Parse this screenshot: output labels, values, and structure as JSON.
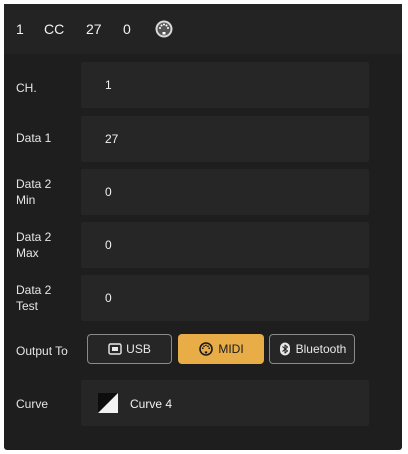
{
  "header": {
    "channel": "1",
    "type": "CC",
    "data1": "27",
    "value": "0",
    "icon": "midi-din-icon"
  },
  "rows": {
    "channel": {
      "label": "CH.",
      "value": "1"
    },
    "data1": {
      "label": "Data 1",
      "value": "27"
    },
    "data2_min": {
      "label_line1": "Data 2",
      "label_line2": "Min",
      "value": "0"
    },
    "data2_max": {
      "label_line1": "Data 2",
      "label_line2": "Max",
      "value": "0"
    },
    "data2_test": {
      "label_line1": "Data 2",
      "label_line2": "Test",
      "value": "0"
    }
  },
  "output_to": {
    "label": "Output To",
    "options": [
      {
        "label": "USB",
        "icon": "usb-icon",
        "selected": false
      },
      {
        "label": "MIDI",
        "icon": "midi-din-icon",
        "selected": true
      },
      {
        "label": "Bluetooth",
        "icon": "bluetooth-icon",
        "selected": false
      }
    ]
  },
  "curve": {
    "label": "Curve",
    "value": "Curve 4",
    "icon": "curve-icon"
  },
  "colors": {
    "background": "#1e1e1e",
    "field": "#262626",
    "accent": "#e9ad48",
    "text": "#f2f2f2"
  }
}
